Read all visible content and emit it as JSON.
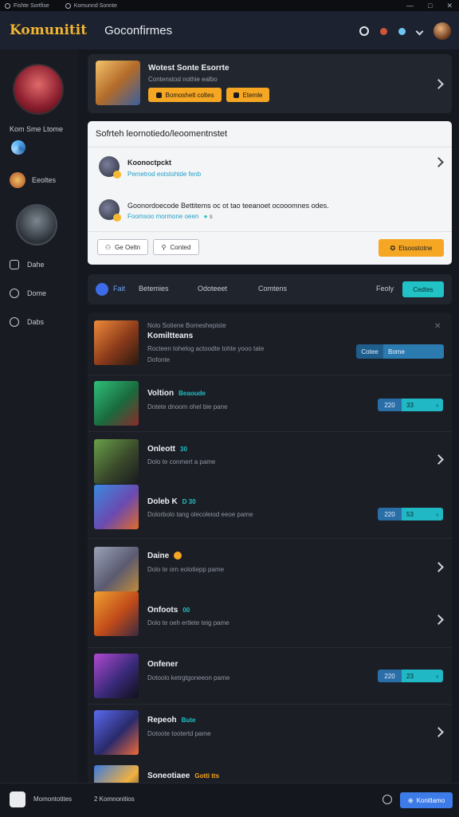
{
  "titlebar": {
    "tab1": "Fishte Sortfise",
    "tab2": "Komunnd Sonnte",
    "controls": [
      "—",
      "□",
      "✕"
    ]
  },
  "header": {
    "logo": "Komunitit",
    "title": "Goconfirmes"
  },
  "sidebar": {
    "name": "Kom Sme Ltome",
    "friend_label": "Eeoltes",
    "nav": [
      {
        "label": "Dahe",
        "icon": "edit-icon"
      },
      {
        "label": "Dome",
        "icon": "plus-circle-icon"
      },
      {
        "label": "Dabs",
        "icon": "info-icon"
      }
    ]
  },
  "featured": {
    "title": "Wotest Sonte Esorrte",
    "subtitle": "Contenstod nothie ealbo",
    "button1": "Bomoshelt coltes",
    "button2": "Etemle"
  },
  "panel": {
    "title": "Sofrteh leornotiedo/leoomentnstet",
    "item1_title": "Koonoctpckt",
    "item1_sub": "Pemetrod eotstohtde fenb",
    "item2_title": "Goonordoecode Bettitems oc ot tao teeanoet ocooomnes odes.",
    "item2_sub": "Foomsoo mormone oeen",
    "item2_badge": "s",
    "btn1": "Ge Oeltn",
    "btn2": "Conted",
    "btn_primary": "Etsoostotne"
  },
  "filters": {
    "tabs": [
      "Fait",
      "Betemies",
      "Odoteeet",
      "Comtens"
    ],
    "right_label": "Feoly",
    "button": "Cedtes"
  },
  "rows": [
    {
      "title": "Komiltteans",
      "over": "Nolo Sotiene Bomeshepiste",
      "sub": "Rocteen tohelog actoodte tohte yooo tate",
      "meta": "Dofonte",
      "pill_a": "Cotee",
      "pill_b": "Bome"
    },
    {
      "title": "Voltion",
      "tag": "Beaoude",
      "sub": "Dotete dnoom ohel bie pane",
      "pill_a": "220",
      "pill_b": "33"
    },
    {
      "title": "Onleott",
      "tag": "30",
      "sub": "Dolo te conmert a pame"
    },
    {
      "title": "Doleb K",
      "tag": "D 30",
      "sub": "Dolorbolo tang olecoleiod eeoe pame",
      "pill_a": "220",
      "pill_b": "53"
    },
    {
      "title": "Daine",
      "sub": "Dolo te orn eolotiepp pame"
    },
    {
      "title": "Onfoots",
      "tag": "00",
      "sub": "Dolo te oeh ertlete teig pame"
    },
    {
      "title": "Onfener",
      "sub": "Dotoolo ketrgtgoneeon pame",
      "pill_a": "220",
      "pill_b": "23"
    },
    {
      "title": "Repeoh",
      "tag": "Bute",
      "sub": "Dotoote tootertd pame"
    },
    {
      "title": "Soneotiaee",
      "tag": "Gotti tts"
    }
  ],
  "footer": {
    "label": "Momontotites",
    "label2": "2 Komnonitios",
    "button": "Konitlamo"
  },
  "colors": {
    "accent_orange": "#f5a623",
    "accent_cyan": "#21c2c6",
    "accent_blue": "#3d7be8",
    "bg": "#15181e"
  }
}
